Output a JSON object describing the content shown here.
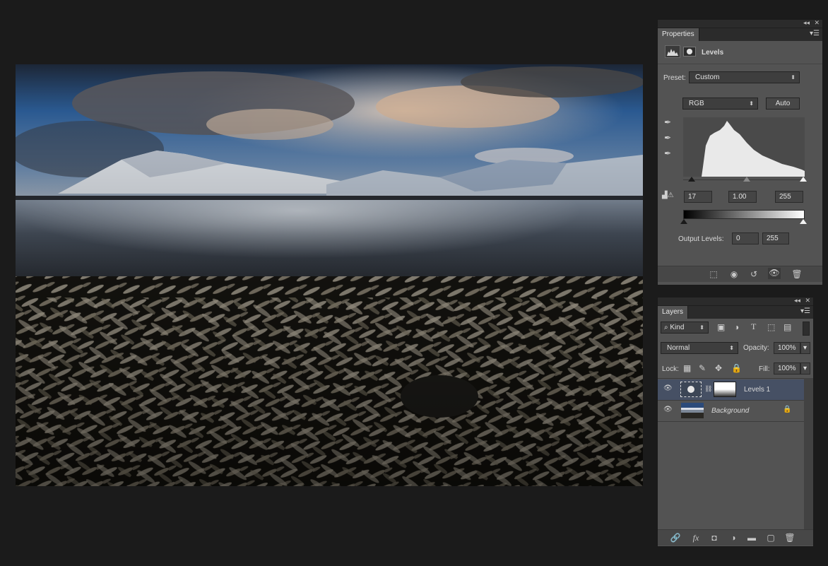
{
  "properties_panel": {
    "tab_label": "Properties",
    "adjustment_title": "Levels",
    "preset_label": "Preset:",
    "preset_value": "Custom",
    "channel_value": "RGB",
    "auto_label": "Auto",
    "input_black": "17",
    "input_gamma": "1.00",
    "input_white": "255",
    "output_label": "Output Levels:",
    "output_black": "0",
    "output_white": "255"
  },
  "layers_panel": {
    "tab_label": "Layers",
    "filter_kind": "Kind",
    "blend_mode": "Normal",
    "opacity_label": "Opacity:",
    "opacity_value": "100%",
    "lock_label": "Lock:",
    "fill_label": "Fill:",
    "fill_value": "100%",
    "layers": [
      {
        "name": "Levels 1",
        "selected": true
      },
      {
        "name": "Background",
        "selected": false
      }
    ]
  },
  "colors": {
    "workspace_bg": "#1b1b1b",
    "panel_body": "#535353",
    "selected_layer": "#465064"
  },
  "icons": [
    "collapse-icon",
    "close-icon",
    "panel-menu-icon",
    "levels-adjustment-icon",
    "mask-icon",
    "eyedropper-black-icon",
    "eyedropper-gray-icon",
    "eyedropper-white-icon",
    "warning-icon",
    "clip-to-layer-icon",
    "view-previous-icon",
    "reset-icon",
    "visibility-icon",
    "trash-icon",
    "search-icon",
    "image-filter-icon",
    "adjustment-filter-icon",
    "type-filter-icon",
    "shape-filter-icon",
    "smart-object-filter-icon",
    "lock-transparent-icon",
    "lock-image-icon",
    "lock-position-icon",
    "lock-all-icon",
    "eye-icon",
    "link-icon",
    "fx-icon",
    "add-mask-icon",
    "new-adjustment-icon",
    "new-group-icon",
    "new-layer-icon"
  ]
}
